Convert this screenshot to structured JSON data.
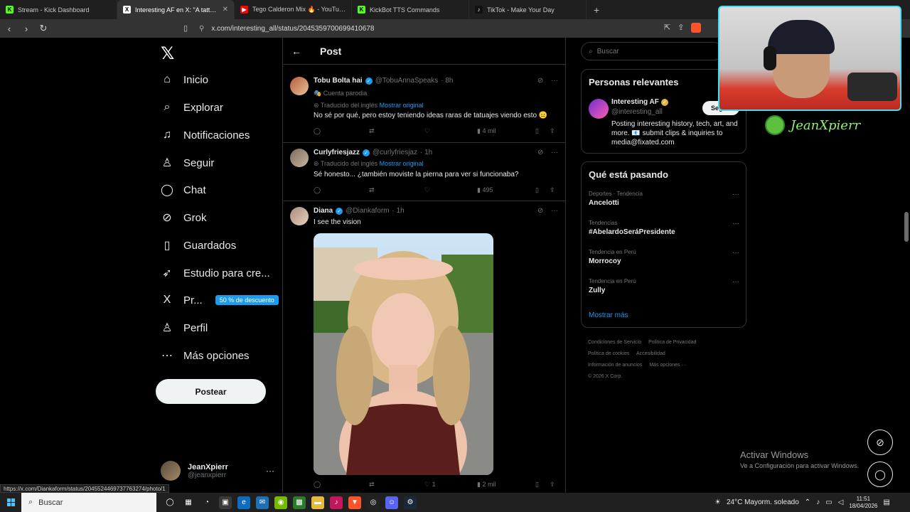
{
  "browser": {
    "tabs": [
      {
        "title": "Stream - Kick Dashboard",
        "fav_color": "#53fc18",
        "fav_char": "K",
        "active": false
      },
      {
        "title": "Interesting AF en X: \"A tattoo th",
        "fav_color": "#000000",
        "fav_char": "X",
        "active": true
      },
      {
        "title": "Tego Calderon Mix 🔥 - YouTube",
        "fav_color": "#ff0000",
        "fav_char": "▶",
        "active": false
      },
      {
        "title": "KickBot TTS Commands",
        "fav_color": "#53fc18",
        "fav_char": "K",
        "active": false
      },
      {
        "title": "TikTok - Make Your Day",
        "fav_color": "#111111",
        "fav_char": "♪",
        "active": false
      }
    ],
    "url": "x.com/interesting_all/status/2045359700699410678",
    "status_url": "https://x.com/Diankaform/status/2045524469737763274/photo/1"
  },
  "nav": {
    "items": [
      {
        "label": "Inicio",
        "icon": "⌂"
      },
      {
        "label": "Explorar",
        "icon": "⌕"
      },
      {
        "label": "Notificaciones",
        "icon": "🔔"
      },
      {
        "label": "Seguir",
        "icon": "⁺"
      },
      {
        "label": "Chat",
        "icon": "◯"
      },
      {
        "label": "Grok",
        "icon": "⊘"
      },
      {
        "label": "Guardados",
        "icon": "▯"
      },
      {
        "label": "Estudio para cre...",
        "icon": "➶"
      },
      {
        "label": "Pr...",
        "icon": "X"
      },
      {
        "label": "Perfil",
        "icon": "♙"
      },
      {
        "label": "Más opciones",
        "icon": "⋯"
      }
    ],
    "promo": "50 % de descuento",
    "post_button": "Postear",
    "account": {
      "name": "JeanXpierr",
      "handle": "@jeanxpierr"
    }
  },
  "post_header": {
    "title": "Post"
  },
  "tweets": [
    {
      "name": "Tobu Bolta hai",
      "handle": "@TobuAnnaSpeaks",
      "time": "· 8h",
      "parody": "Cuenta parodia",
      "translated": "Traducido del inglés",
      "show_original": "Mostrar original",
      "text": "No sé por qué, pero estoy teniendo ideas raras de tatuajes viendo esto 😐",
      "views": "4 mil",
      "likes": "",
      "reposts": ""
    },
    {
      "name": "Curlyfriesjazz",
      "handle": "@curlyfriesjaz",
      "time": "· 1h",
      "translated": "Traducido del inglés",
      "show_original": "Mostrar original",
      "text": "Sé honesto... ¿también moviste la pierna para ver si funcionaba?",
      "views": "495"
    },
    {
      "name": "Diana",
      "handle": "@Diankaform",
      "time": "· 1h",
      "text": "I see the vision",
      "likes": "1",
      "views": "2 mil"
    }
  ],
  "right": {
    "search_placeholder": "Buscar",
    "relevant": {
      "title": "Personas relevantes",
      "name": "Interesting AF",
      "handle": "@interesting_all",
      "bio": "Posting interesting history, tech, art, and more. 📧 submit clips & inquiries to media@fixated.com",
      "follow": "Seguir"
    },
    "trending": {
      "title": "Qué está pasando",
      "items": [
        {
          "category": "Deportes · Tendencia",
          "topic": "Ancelotti"
        },
        {
          "category": "Tendencias",
          "topic": "#AbelardoSeráPresidente"
        },
        {
          "category": "Tendencia en Perú",
          "topic": "Morrocoy"
        },
        {
          "category": "Tendencia en Perú",
          "topic": "Zully"
        }
      ],
      "show_more": "Mostrar más"
    },
    "footer": [
      "Condiciones de Servicio",
      "Política de Privacidad",
      "Política de cookies",
      "Accesibilidad",
      "Información de anuncios",
      "Más opciones ···",
      "© 2026 X Corp."
    ]
  },
  "overlay": {
    "streamer_name": "JeanXpierr",
    "activate_title": "Activar Windows",
    "activate_sub": "Ve a Configuración para activar Windows."
  },
  "taskbar": {
    "search": "Buscar",
    "weather": "24°C  Mayorm. soleado",
    "time": "11:51",
    "date": "18/04/2026"
  },
  "colors": {
    "accent": "#1d9bf0",
    "background": "#000000",
    "border": "#2f3336"
  }
}
